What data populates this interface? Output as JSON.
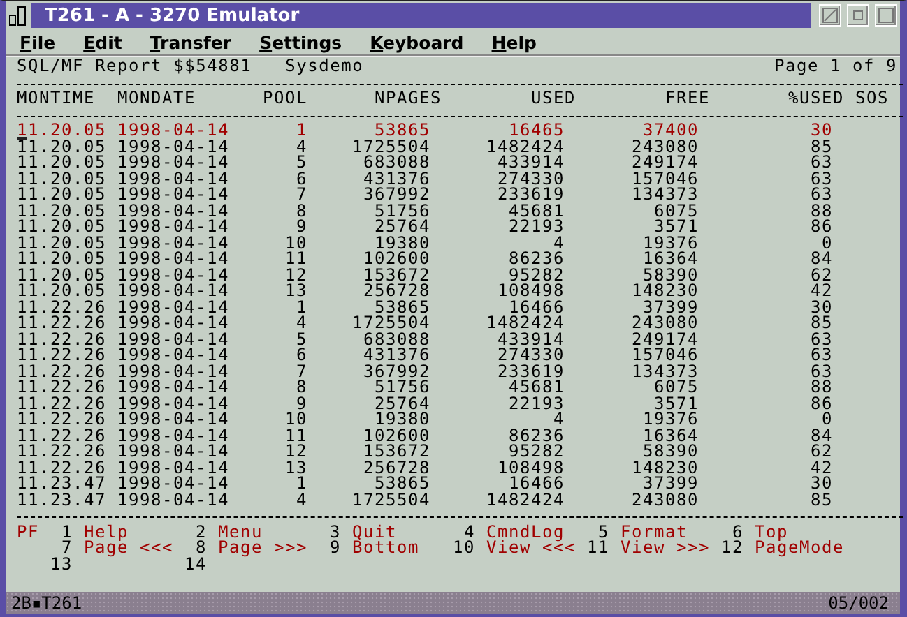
{
  "window": {
    "title": "T261 - A - 3270 Emulator"
  },
  "menu": [
    "File",
    "Edit",
    "Transfer",
    "Settings",
    "Keyboard",
    "Help"
  ],
  "report": {
    "title": "SQL/MF Report $$54881   Sysdemo",
    "page": "Page 1 of 9"
  },
  "columns": [
    "MONTIME",
    "MONDATE",
    "POOL",
    "NPAGES",
    "USED",
    "FREE",
    "%USED",
    "SOS"
  ],
  "rows": [
    {
      "montime": "11.20.05",
      "mondate": "1998-04-14",
      "pool": "1",
      "npages": "53865",
      "used": "16465",
      "free": "37400",
      "pct_used": "30",
      "highlight": true,
      "cursor": true
    },
    {
      "montime": "11.20.05",
      "mondate": "1998-04-14",
      "pool": "4",
      "npages": "1725504",
      "used": "1482424",
      "free": "243080",
      "pct_used": "85",
      "highlight": false,
      "cursor": false
    },
    {
      "montime": "11.20.05",
      "mondate": "1998-04-14",
      "pool": "5",
      "npages": "683088",
      "used": "433914",
      "free": "249174",
      "pct_used": "63",
      "highlight": false,
      "cursor": false
    },
    {
      "montime": "11.20.05",
      "mondate": "1998-04-14",
      "pool": "6",
      "npages": "431376",
      "used": "274330",
      "free": "157046",
      "pct_used": "63",
      "highlight": false,
      "cursor": false
    },
    {
      "montime": "11.20.05",
      "mondate": "1998-04-14",
      "pool": "7",
      "npages": "367992",
      "used": "233619",
      "free": "134373",
      "pct_used": "63",
      "highlight": false,
      "cursor": false
    },
    {
      "montime": "11.20.05",
      "mondate": "1998-04-14",
      "pool": "8",
      "npages": "51756",
      "used": "45681",
      "free": "6075",
      "pct_used": "88",
      "highlight": false,
      "cursor": false
    },
    {
      "montime": "11.20.05",
      "mondate": "1998-04-14",
      "pool": "9",
      "npages": "25764",
      "used": "22193",
      "free": "3571",
      "pct_used": "86",
      "highlight": false,
      "cursor": false
    },
    {
      "montime": "11.20.05",
      "mondate": "1998-04-14",
      "pool": "10",
      "npages": "19380",
      "used": "4",
      "free": "19376",
      "pct_used": "0",
      "highlight": false,
      "cursor": false
    },
    {
      "montime": "11.20.05",
      "mondate": "1998-04-14",
      "pool": "11",
      "npages": "102600",
      "used": "86236",
      "free": "16364",
      "pct_used": "84",
      "highlight": false,
      "cursor": false
    },
    {
      "montime": "11.20.05",
      "mondate": "1998-04-14",
      "pool": "12",
      "npages": "153672",
      "used": "95282",
      "free": "58390",
      "pct_used": "62",
      "highlight": false,
      "cursor": false
    },
    {
      "montime": "11.20.05",
      "mondate": "1998-04-14",
      "pool": "13",
      "npages": "256728",
      "used": "108498",
      "free": "148230",
      "pct_used": "42",
      "highlight": false,
      "cursor": false
    },
    {
      "montime": "11.22.26",
      "mondate": "1998-04-14",
      "pool": "1",
      "npages": "53865",
      "used": "16466",
      "free": "37399",
      "pct_used": "30",
      "highlight": false,
      "cursor": false
    },
    {
      "montime": "11.22.26",
      "mondate": "1998-04-14",
      "pool": "4",
      "npages": "1725504",
      "used": "1482424",
      "free": "243080",
      "pct_used": "85",
      "highlight": false,
      "cursor": false
    },
    {
      "montime": "11.22.26",
      "mondate": "1998-04-14",
      "pool": "5",
      "npages": "683088",
      "used": "433914",
      "free": "249174",
      "pct_used": "63",
      "highlight": false,
      "cursor": false
    },
    {
      "montime": "11.22.26",
      "mondate": "1998-04-14",
      "pool": "6",
      "npages": "431376",
      "used": "274330",
      "free": "157046",
      "pct_used": "63",
      "highlight": false,
      "cursor": false
    },
    {
      "montime": "11.22.26",
      "mondate": "1998-04-14",
      "pool": "7",
      "npages": "367992",
      "used": "233619",
      "free": "134373",
      "pct_used": "63",
      "highlight": false,
      "cursor": false
    },
    {
      "montime": "11.22.26",
      "mondate": "1998-04-14",
      "pool": "8",
      "npages": "51756",
      "used": "45681",
      "free": "6075",
      "pct_used": "88",
      "highlight": false,
      "cursor": false
    },
    {
      "montime": "11.22.26",
      "mondate": "1998-04-14",
      "pool": "9",
      "npages": "25764",
      "used": "22193",
      "free": "3571",
      "pct_used": "86",
      "highlight": false,
      "cursor": false
    },
    {
      "montime": "11.22.26",
      "mondate": "1998-04-14",
      "pool": "10",
      "npages": "19380",
      "used": "4",
      "free": "19376",
      "pct_used": "0",
      "highlight": false,
      "cursor": false
    },
    {
      "montime": "11.22.26",
      "mondate": "1998-04-14",
      "pool": "11",
      "npages": "102600",
      "used": "86236",
      "free": "16364",
      "pct_used": "84",
      "highlight": false,
      "cursor": false
    },
    {
      "montime": "11.22.26",
      "mondate": "1998-04-14",
      "pool": "12",
      "npages": "153672",
      "used": "95282",
      "free": "58390",
      "pct_used": "62",
      "highlight": false,
      "cursor": false
    },
    {
      "montime": "11.22.26",
      "mondate": "1998-04-14",
      "pool": "13",
      "npages": "256728",
      "used": "108498",
      "free": "148230",
      "pct_used": "42",
      "highlight": false,
      "cursor": false
    },
    {
      "montime": "11.23.47",
      "mondate": "1998-04-14",
      "pool": "1",
      "npages": "53865",
      "used": "16466",
      "free": "37399",
      "pct_used": "30",
      "highlight": false,
      "cursor": false
    },
    {
      "montime": "11.23.47",
      "mondate": "1998-04-14",
      "pool": "4",
      "npages": "1725504",
      "used": "1482424",
      "free": "243080",
      "pct_used": "85",
      "highlight": false,
      "cursor": false
    }
  ],
  "pf_label": "PF",
  "pf_keys": [
    {
      "number": "1",
      "label": "Help"
    },
    {
      "number": "2",
      "label": "Menu"
    },
    {
      "number": "3",
      "label": "Quit"
    },
    {
      "number": "4",
      "label": "CmndLog"
    },
    {
      "number": "5",
      "label": "Format"
    },
    {
      "number": "6",
      "label": "Top"
    },
    {
      "number": "7",
      "label": "Page <<<"
    },
    {
      "number": "8",
      "label": "Page >>>"
    },
    {
      "number": "9",
      "label": "Bottom"
    },
    {
      "number": "10",
      "label": "View <<<"
    },
    {
      "number": "11",
      "label": "View >>>"
    },
    {
      "number": "12",
      "label": "PageMode"
    },
    {
      "number": "13"
    },
    {
      "number": "14"
    }
  ],
  "status_bar": {
    "session": "2B▪T261",
    "position": "05/002"
  }
}
